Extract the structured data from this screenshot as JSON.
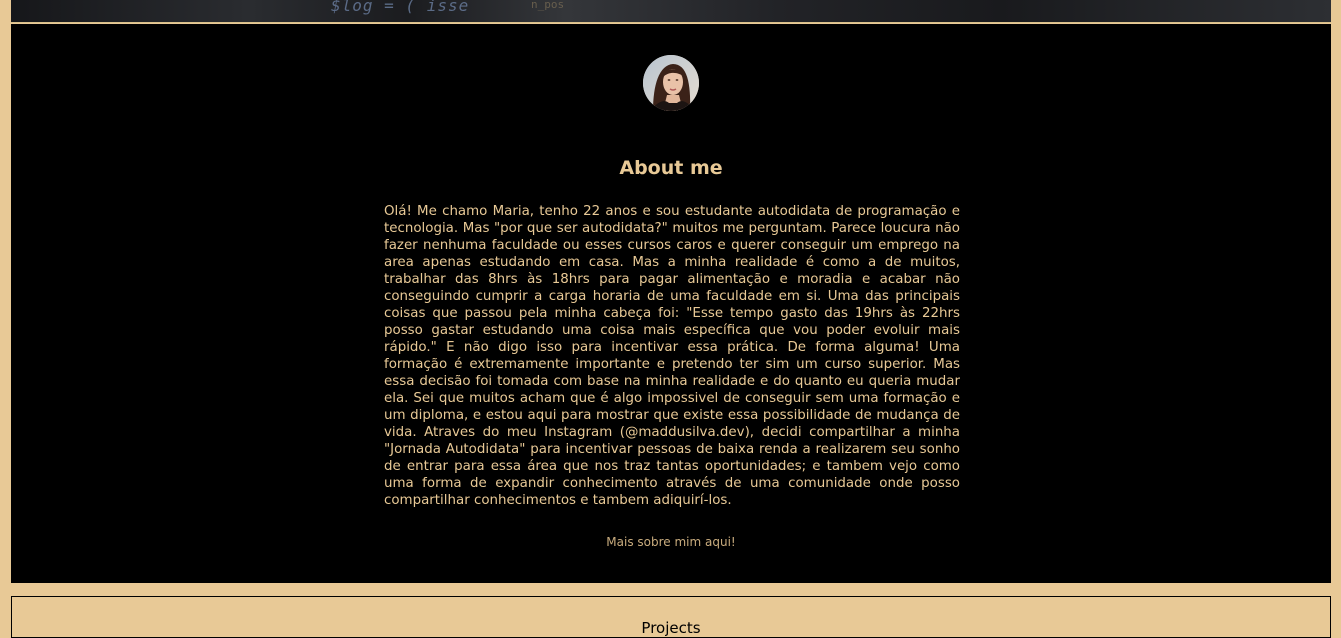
{
  "hero": {
    "code_fragment": "$log = ( isse",
    "code_fragment_2": "n_pos"
  },
  "about": {
    "title": "About me",
    "paragraph": "Olá! Me chamo Maria, tenho 22 anos e sou estudante autodidata de programação e tecnologia. Mas \"por que ser autodidata?\" muitos me perguntam. Parece loucura não fazer nenhuma faculdade ou esses cursos caros e querer conseguir um emprego na area apenas estudando em casa. Mas a minha realidade é como a de muitos, trabalhar das 8hrs às 18hrs para pagar alimentação e moradia e acabar não conseguindo cumprir a carga horaria de uma faculdade em si. Uma das principais coisas que passou pela minha cabeça foi: \"Esse tempo gasto das 19hrs às 22hrs posso gastar estudando uma coisa mais específica que vou poder evoluir mais rápido.\" E não digo isso para incentivar essa prática. De forma alguma! Uma formação é extremamente importante e pretendo ter sim um curso superior. Mas essa decisão foi tomada com base na minha realidade e do quanto eu queria mudar ela. Sei que muitos acham que é algo impossivel de conseguir sem uma formação e um diploma, e estou aqui para mostrar que existe essa possibilidade de mudança de vida. Atraves do meu Instagram (@maddusilva.dev), decidi compartilhar a minha \"Jornada Autodidata\" para incentivar pessoas de baixa renda a realizarem seu sonho de entrar para essa área que nos traz tantas oportunidades; e tambem vejo como uma forma de expandir conhecimento através de uma comunidade onde posso compartilhar conhecimentos e tambem adiquirí-los.",
    "more_link": "Mais sobre mim aqui!"
  },
  "next_section": {
    "title": "Projects"
  },
  "colors": {
    "accent": "#E8C996",
    "background": "#000000",
    "link": "#C9AC7E"
  }
}
